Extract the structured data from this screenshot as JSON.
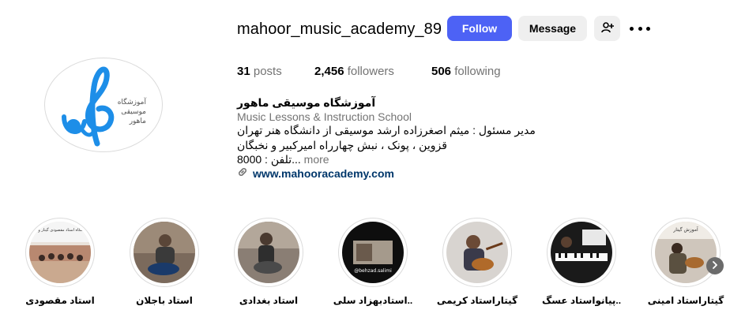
{
  "profile": {
    "username": "mahoor_music_academy_89",
    "follow_label": "Follow",
    "message_label": "Message",
    "avatar_text": {
      "line1": "آموزشگاه",
      "line2": "موسیقی",
      "line3": "ماهور"
    }
  },
  "stats": {
    "posts_count": "31",
    "posts_label": "posts",
    "followers_count": "2,456",
    "followers_label": "followers",
    "following_count": "506",
    "following_label": "following"
  },
  "bio": {
    "name": "آموزشگاه موسیقی ماهور",
    "category": "Music Lessons & Instruction School",
    "line1": "مدیر مسئول : میثم اصغرزاده ارشد موسیقی از دانشگاه هنر تهران",
    "line2": "قزوین ، پونک ، نبش چهارراه امیرکبیر و نخبگان",
    "line3": "تلفن : 8000...",
    "more": "more",
    "link": "www.mahooracademy.com"
  },
  "highlights": [
    {
      "label": "استاد مقصودی",
      "overlay": "نمایشگاه استاد مقصودی گیتار و تنبک"
    },
    {
      "label": "استاد باجلان",
      "overlay": ""
    },
    {
      "label": "استاد بغدادی",
      "overlay": ""
    },
    {
      "label": "استادبهزاد سلی..",
      "overlay": "@behzad.salimi"
    },
    {
      "label": "گیتاراستاد کریمی",
      "overlay": ""
    },
    {
      "label": "پیانواستاد عسگ..",
      "overlay": ""
    },
    {
      "label": "گیتاراستاد امینی",
      "overlay": "آموزش گیتار"
    }
  ],
  "colors": {
    "follow_bg": "#4d62f5",
    "brand_blue": "#1d8ee8",
    "link": "#00376b",
    "muted": "#737373"
  },
  "icons": {
    "add_user": "add-user-icon",
    "more": "more-icon",
    "link": "link-icon",
    "next": "chevron-right-icon"
  }
}
